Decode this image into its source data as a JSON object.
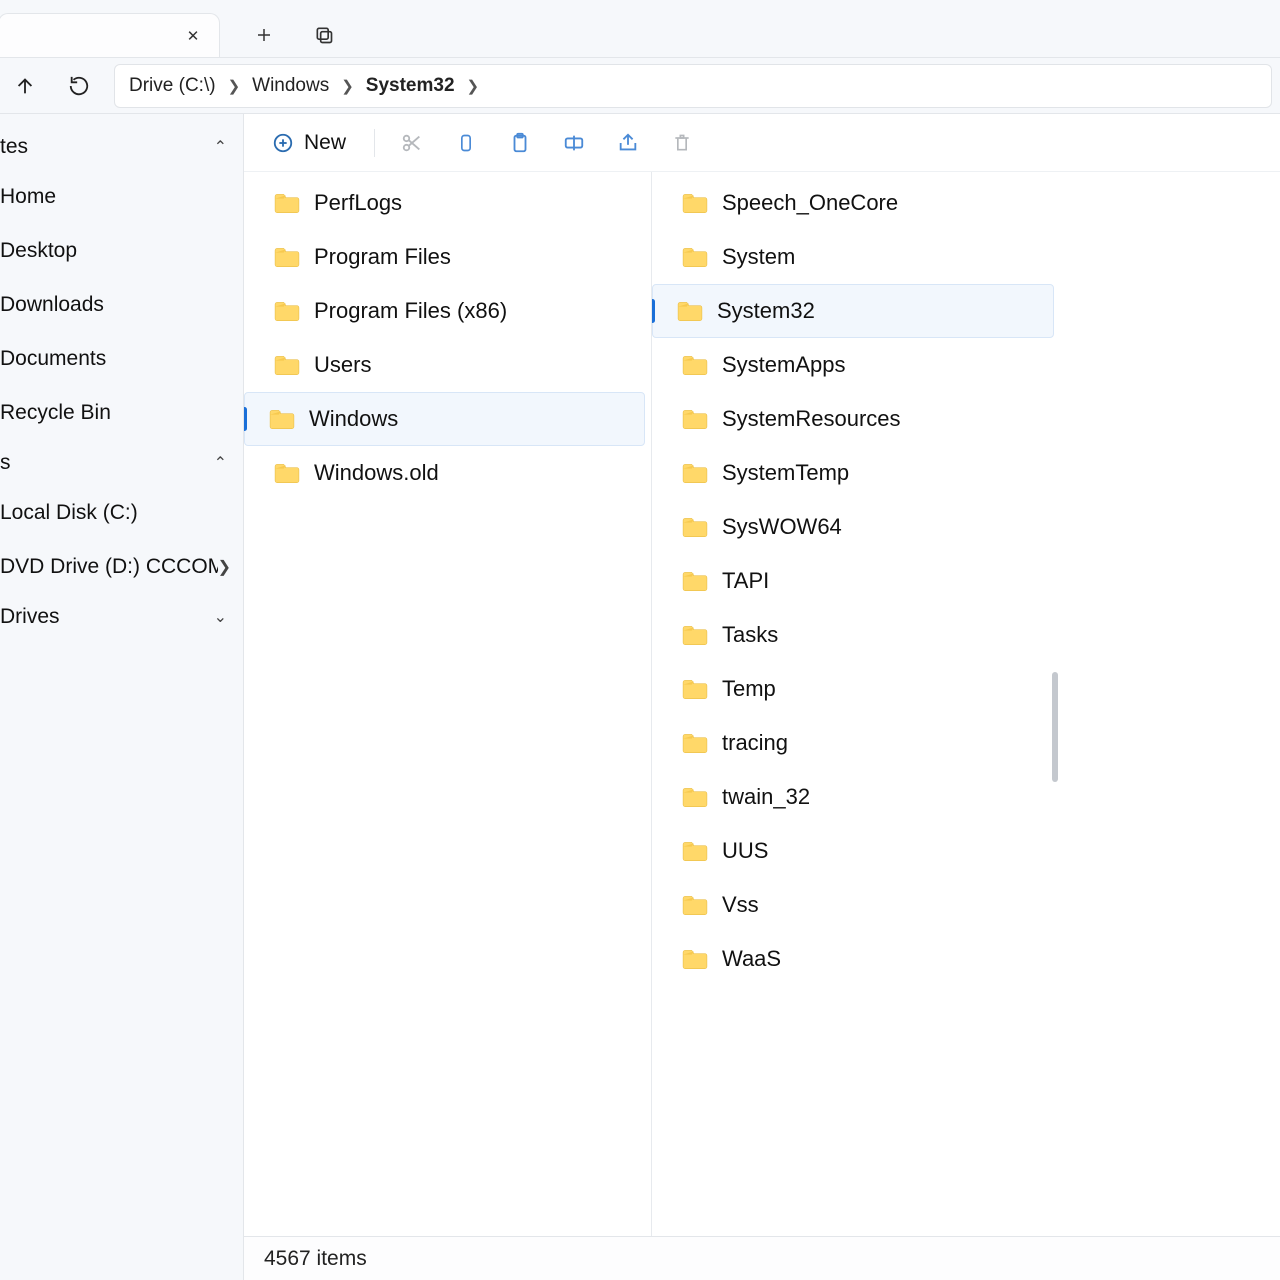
{
  "tab": {
    "close_glyph": "✕"
  },
  "nav": {
    "crumbs": [
      {
        "label": "Drive (C:\\)"
      },
      {
        "label": "Windows"
      },
      {
        "label": "System32",
        "current": true
      }
    ]
  },
  "sidebar": {
    "header1_label": "tes",
    "items1": [
      {
        "label": "Home"
      },
      {
        "label": "Desktop"
      },
      {
        "label": "Downloads"
      },
      {
        "label": "Documents"
      },
      {
        "label": "Recycle Bin"
      }
    ],
    "header2_label": "s",
    "items2": [
      {
        "label": "Local Disk (C:)"
      },
      {
        "label": "DVD Drive (D:) CCCOMA_",
        "trail_chev": true
      }
    ],
    "header3_label": "Drives"
  },
  "toolbar": {
    "new_label": "New"
  },
  "column1": {
    "items": [
      {
        "name": "PerfLogs"
      },
      {
        "name": "Program Files"
      },
      {
        "name": "Program Files (x86)"
      },
      {
        "name": "Users"
      },
      {
        "name": "Windows",
        "selected": true
      },
      {
        "name": "Windows.old"
      }
    ]
  },
  "column2": {
    "items": [
      {
        "name": "Speech_OneCore"
      },
      {
        "name": "System"
      },
      {
        "name": "System32",
        "selected": true
      },
      {
        "name": "SystemApps"
      },
      {
        "name": "SystemResources"
      },
      {
        "name": "SystemTemp"
      },
      {
        "name": "SysWOW64"
      },
      {
        "name": "TAPI"
      },
      {
        "name": "Tasks"
      },
      {
        "name": "Temp"
      },
      {
        "name": "tracing"
      },
      {
        "name": "twain_32"
      },
      {
        "name": "UUS"
      },
      {
        "name": "Vss"
      },
      {
        "name": "WaaS"
      }
    ]
  },
  "status": {
    "text": "4567 items"
  }
}
